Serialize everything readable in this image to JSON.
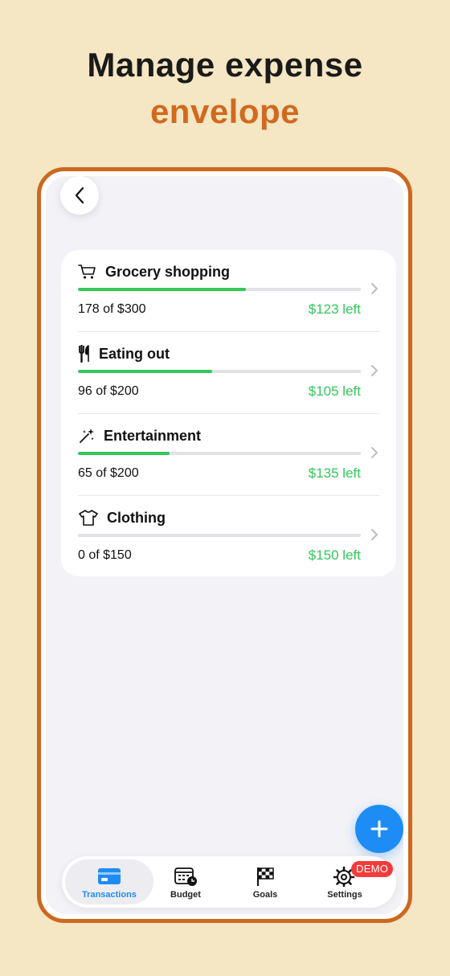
{
  "headline": {
    "line1": "Manage expense",
    "line2": "envelope"
  },
  "nav": {
    "back_icon": "chevron-left-icon"
  },
  "envelopes": [
    {
      "name": "Grocery shopping",
      "icon": "cart-icon",
      "spent": "178 of $300",
      "left": "$123 left",
      "progress": 0.593
    },
    {
      "name": "Eating out",
      "icon": "fork-knife-icon",
      "spent": "96 of $200",
      "left": "$105 left",
      "progress": 0.475
    },
    {
      "name": "Entertainment",
      "icon": "magic-wand-icon",
      "spent": "65 of $200",
      "left": "$135 left",
      "progress": 0.325
    },
    {
      "name": "Clothing",
      "icon": "tshirt-icon",
      "spent": "0 of $150",
      "left": "$150 left",
      "progress": 0
    }
  ],
  "fab": {
    "icon": "plus-icon"
  },
  "tabs": [
    {
      "label": "Transactions",
      "icon": "credit-card-icon",
      "active": true
    },
    {
      "label": "Budget",
      "icon": "calendar-clock-icon",
      "active": false
    },
    {
      "label": "Goals",
      "icon": "checkered-flag-icon",
      "active": false
    },
    {
      "label": "Settings",
      "icon": "gear-icon",
      "active": false
    }
  ],
  "badge": {
    "text": "DEMO"
  },
  "colors": {
    "accent": "#1E8CF5",
    "positive": "#34C759",
    "brand": "#D06A1F",
    "frame": "#CC6820",
    "badge": "#F23B3B",
    "background": "#F5E6C4"
  }
}
